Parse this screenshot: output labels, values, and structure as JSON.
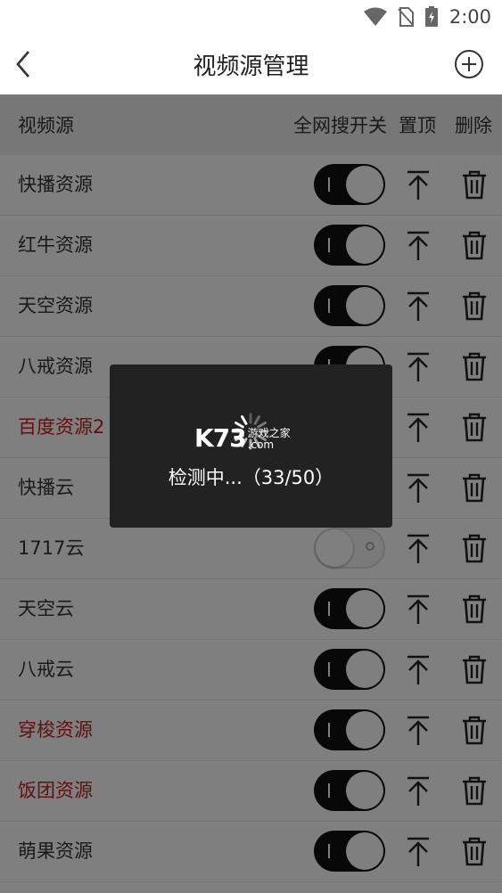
{
  "status_bar": {
    "time": "2:00",
    "icons": [
      "wifi-icon",
      "no-sim-icon",
      "battery-charging-icon"
    ]
  },
  "header": {
    "title": "视频源管理",
    "back_icon": "back-arrow-icon",
    "add_icon": "add-circle-icon"
  },
  "columns": {
    "source": "视频源",
    "search_toggle": "全网搜开关",
    "pin": "置顶",
    "delete": "删除"
  },
  "sources": [
    {
      "name": "快播资源",
      "enabled": true,
      "highlight": false
    },
    {
      "name": "红牛资源",
      "enabled": true,
      "highlight": false
    },
    {
      "name": "天空资源",
      "enabled": true,
      "highlight": false
    },
    {
      "name": "八戒资源",
      "enabled": true,
      "highlight": false
    },
    {
      "name": "百度资源2",
      "enabled": false,
      "highlight": true
    },
    {
      "name": "快播云",
      "enabled": true,
      "highlight": false
    },
    {
      "name": "1717云",
      "enabled": false,
      "highlight": false
    },
    {
      "name": "天空云",
      "enabled": true,
      "highlight": false
    },
    {
      "name": "八戒云",
      "enabled": true,
      "highlight": false
    },
    {
      "name": "穿梭资源",
      "enabled": true,
      "highlight": true
    },
    {
      "name": "饭团资源",
      "enabled": true,
      "highlight": true
    },
    {
      "name": "萌果资源",
      "enabled": true,
      "highlight": false
    }
  ],
  "dialog": {
    "progress_text": "检测中...（33/50）",
    "done": 33,
    "total": 50
  },
  "watermark": {
    "logo": "K73",
    "line1": "游戏之家",
    "line2": ".com"
  },
  "colors": {
    "highlight": "#c41e1e",
    "toggle_on": "#111111",
    "dialog_bg": "#222222"
  }
}
